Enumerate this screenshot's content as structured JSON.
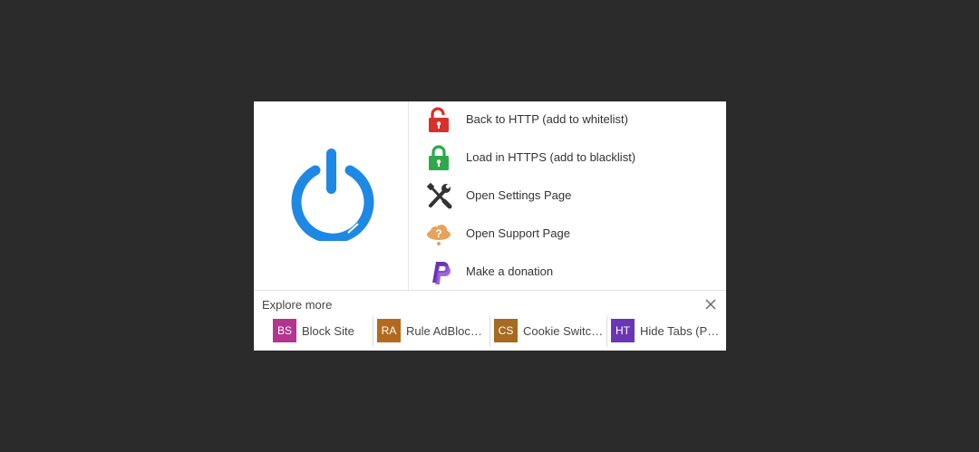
{
  "menu": {
    "items": [
      {
        "label": "Back to HTTP (add to whitelist)",
        "icon": "unlocked-padlock-icon",
        "color": "#d9302c"
      },
      {
        "label": "Load in HTTPS (add to blacklist)",
        "icon": "locked-padlock-icon",
        "color": "#2ea84a"
      },
      {
        "label": "Open Settings Page",
        "icon": "wrench-screwdriver-icon",
        "color": "#333333"
      },
      {
        "label": "Open Support Page",
        "icon": "cloud-question-icon",
        "color": "#e8a25a"
      },
      {
        "label": "Make a donation",
        "icon": "paypal-icon",
        "color": "#6b34b0"
      }
    ]
  },
  "power": {
    "icon": "power-icon",
    "color": "#1e88e5"
  },
  "explore": {
    "title": "Explore more",
    "extensions": [
      {
        "badge": "BS",
        "name": "Block Site",
        "color": "#b5348f"
      },
      {
        "badge": "RA",
        "name": "Rule AdBlocker",
        "color": "#b36a1e"
      },
      {
        "badge": "CS",
        "name": "Cookie Switcher",
        "color": "#a66a20"
      },
      {
        "badge": "HT",
        "name": "Hide Tabs (Panic Button)",
        "color": "#6a36b5"
      }
    ]
  }
}
